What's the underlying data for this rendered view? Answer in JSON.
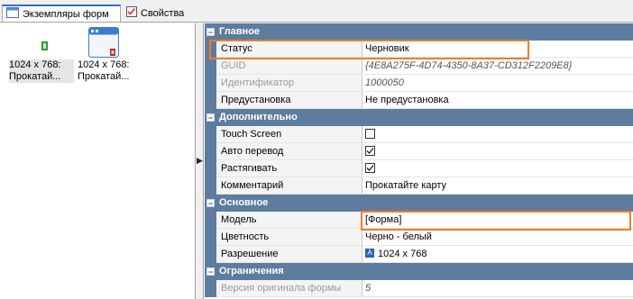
{
  "tabs": [
    {
      "label": "Экземпляры форм",
      "icon": "window-icon",
      "active": true
    },
    {
      "label": "Свойства",
      "icon": "properties-icon",
      "active": false
    }
  ],
  "instances": [
    {
      "line1": "1024 x 768:",
      "line2": "Прокатай...",
      "icon": "small-form-icon",
      "selected": true
    },
    {
      "line1": "1024 x 768:",
      "line2": "Прокатай...",
      "icon": "form-window-icon",
      "selected": false
    }
  ],
  "categories": {
    "main": "Главное",
    "additional": "Дополнительно",
    "basic": "Основное",
    "limits": "Ограничения"
  },
  "props": {
    "status": {
      "name": "Статус",
      "value": "Черновик"
    },
    "guid": {
      "name": "GUID",
      "value": "{4E8A275F-4D74-4350-8A37-CD312F2209E8}"
    },
    "id": {
      "name": "Идентификатор",
      "value": "1000050"
    },
    "preset": {
      "name": "Предустановка",
      "value": "Не предустановка"
    },
    "touch": {
      "name": "Touch Screen",
      "checked": false
    },
    "autotr": {
      "name": "Авто перевод",
      "checked": true
    },
    "stretch": {
      "name": "Растягивать",
      "checked": true
    },
    "comment": {
      "name": "Комментарий",
      "value": "Прокатайте карту"
    },
    "model": {
      "name": "Модель",
      "value": "[Форма]"
    },
    "color": {
      "name": "Цветность",
      "value": "Черно - белый"
    },
    "resolution": {
      "name": "Разрешение",
      "value": "1024 x 768"
    },
    "origver": {
      "name": "Версия оригинала формы",
      "value": "5"
    }
  },
  "colors": {
    "highlight": "#ee7d2a",
    "category": "#5e7c9d"
  }
}
